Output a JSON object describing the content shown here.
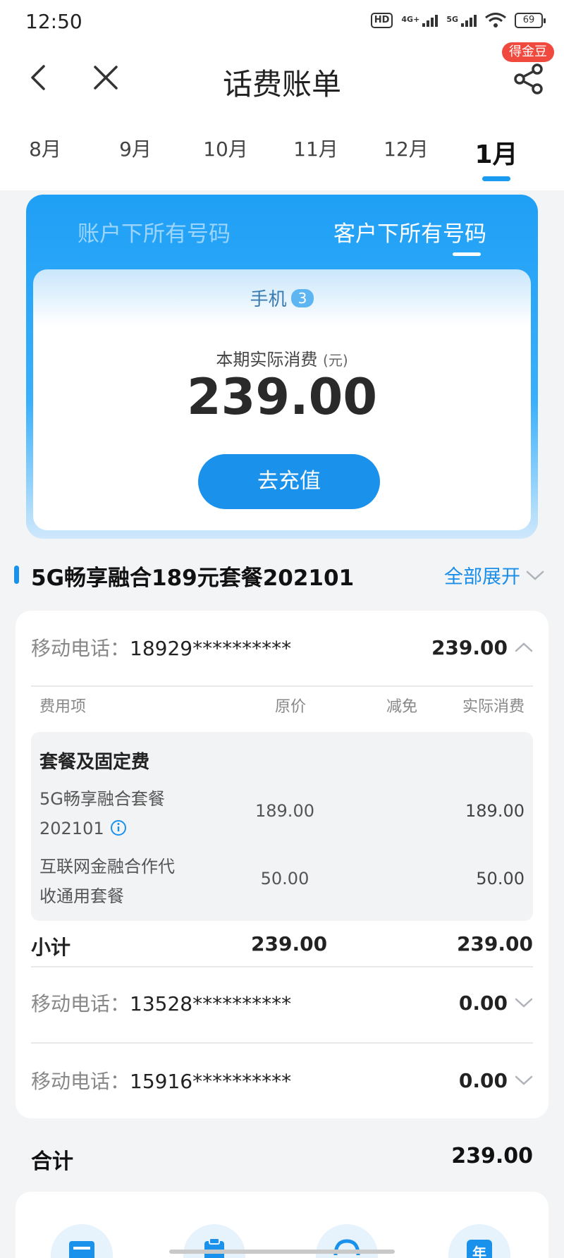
{
  "status_bar": {
    "time": "12:50",
    "hd": "HD",
    "net1": "4G+",
    "net2": "5G",
    "battery": "69"
  },
  "header": {
    "title": "话费账单",
    "badge": "得金豆"
  },
  "months": [
    "8月",
    "9月",
    "10月",
    "11月",
    "12月",
    "1月"
  ],
  "active_month_index": 5,
  "summary": {
    "tabs": [
      "账户下所有号码",
      "客户下所有号码"
    ],
    "active_tab_index": 1,
    "device_label": "手机",
    "device_count": "3",
    "amount_label": "本期实际消费",
    "amount_unit": "(元)",
    "amount": "239.00",
    "recharge_label": "去充值"
  },
  "plan": {
    "title": "5G畅享融合189元套餐202101",
    "expand_all": "全部展开"
  },
  "lines": [
    {
      "label": "移动电话：",
      "number": "18929**********",
      "amount": "239.00",
      "expanded": true
    },
    {
      "label": "移动电话：",
      "number": "13528**********",
      "amount": "0.00",
      "expanded": false
    },
    {
      "label": "移动电话：",
      "number": "15916**********",
      "amount": "0.00",
      "expanded": false
    }
  ],
  "columns": {
    "item": "费用项",
    "original": "原价",
    "discount": "减免",
    "actual": "实际消费"
  },
  "detail": {
    "category": "套餐及固定费",
    "items": [
      {
        "name_line1": "5G畅享融合套餐",
        "name_line2": "202101",
        "original": "189.00",
        "actual": "189.00"
      },
      {
        "name_line1": "互联网金融合作代",
        "name_line2": "收通用套餐",
        "original": "50.00",
        "actual": "50.00"
      }
    ]
  },
  "subtotal": {
    "label": "小计",
    "original": "239.00",
    "actual": "239.00"
  },
  "total": {
    "label": "合计",
    "amount": "239.00"
  },
  "quick_actions": {
    "icon_names": [
      "bill-icon",
      "clipboard-icon",
      "service-icon",
      "annual-icon"
    ],
    "annual_text": "年"
  },
  "colors": {
    "accent": "#1a92ec",
    "badge": "#f0493e",
    "card_gradient_top": "#1f9ff5"
  }
}
